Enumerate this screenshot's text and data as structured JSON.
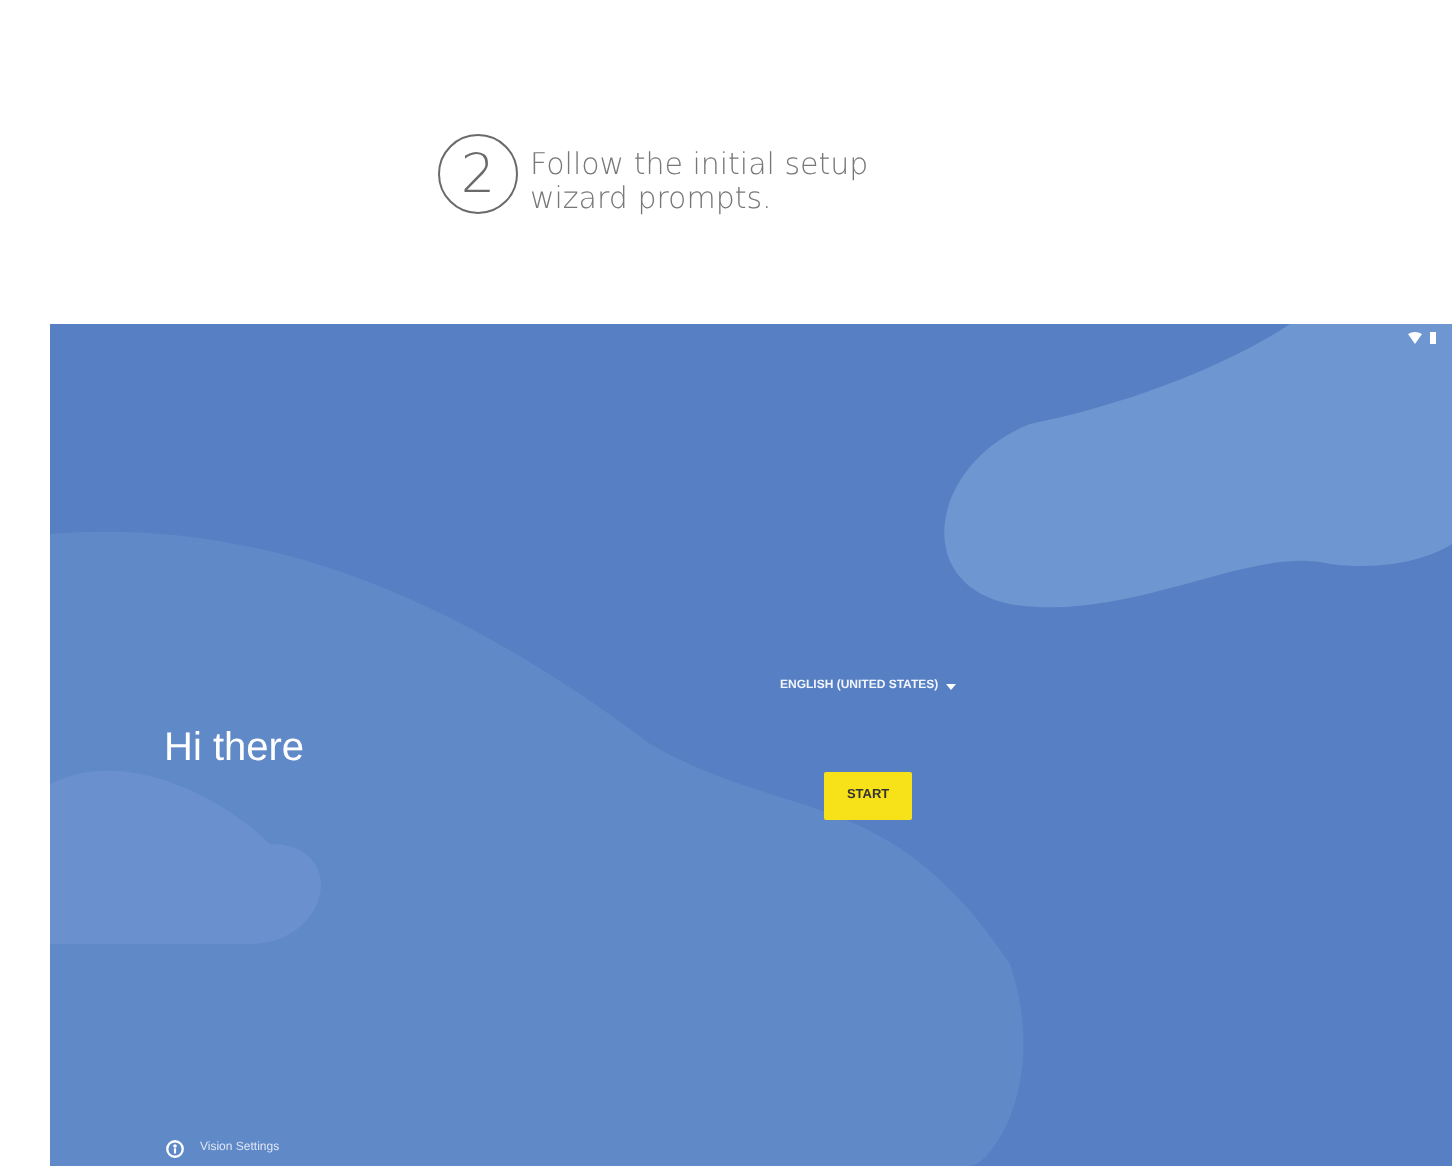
{
  "step": {
    "number": "2",
    "text": "Follow the initial setup wizard prompts."
  },
  "screen": {
    "greeting": "Hi there",
    "language": "ENGLISH (UNITED STATES)",
    "start_button": "START",
    "accessibility_link": "Vision Settings"
  }
}
